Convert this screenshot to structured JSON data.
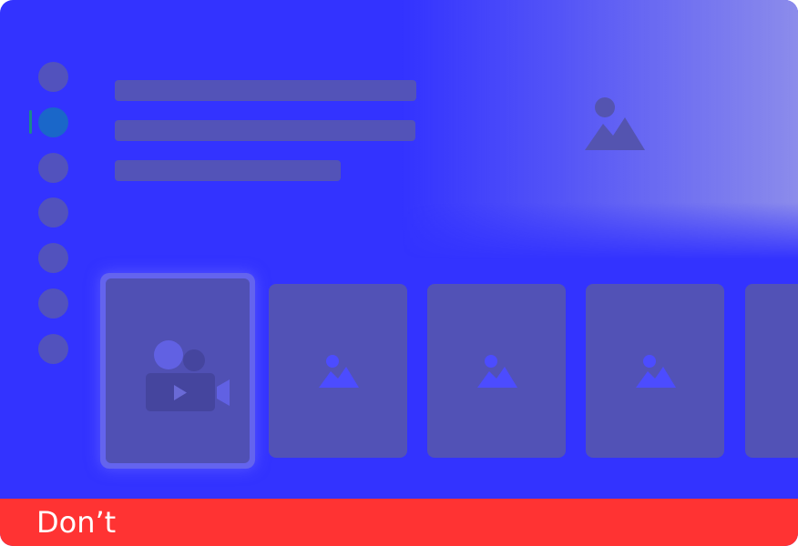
{
  "caption": {
    "text": "Don’t",
    "color": "#ff3333"
  },
  "colors": {
    "background": "#3333ff",
    "placeholder": "#5252b6",
    "focus_ring": "#6464ee",
    "active_dot": "#1a67c9"
  },
  "sidebar": {
    "items": [
      {
        "state": "default"
      },
      {
        "state": "selected"
      },
      {
        "state": "default"
      },
      {
        "state": "default"
      },
      {
        "state": "default"
      },
      {
        "state": "default"
      },
      {
        "state": "default"
      }
    ]
  },
  "hero": {
    "icon": "image-icon",
    "text_lines": 3
  },
  "row": {
    "tiles": [
      {
        "icon": "video-camera-icon",
        "focused": true
      },
      {
        "icon": "image-icon",
        "focused": false
      },
      {
        "icon": "image-icon",
        "focused": false
      },
      {
        "icon": "image-icon",
        "focused": false
      },
      {
        "icon": "image-icon",
        "focused": false
      }
    ]
  }
}
